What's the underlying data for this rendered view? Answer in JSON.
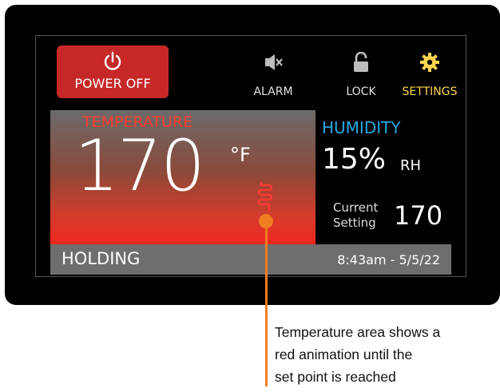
{
  "controls": {
    "power_label": "POWER OFF",
    "alarm_label": "ALARM",
    "lock_label": "LOCK",
    "settings_label": "SETTINGS"
  },
  "temperature": {
    "title": "TEMPERATURE",
    "value": "170",
    "unit": "°F"
  },
  "humidity": {
    "title": "HUMIDITY",
    "value": "15%",
    "unit": "RH"
  },
  "current_setting": {
    "label_line1": "Current",
    "label_line2": "Setting",
    "value": "170"
  },
  "status": {
    "text": "HOLDING",
    "datetime": "8:43am - 5/5/22"
  },
  "callout": {
    "line1": "Temperature area shows a",
    "line2": "red animation until the",
    "line3": "set point is reached"
  },
  "colors": {
    "power": "#c62828",
    "temperature": "#ff3b30",
    "humidity": "#29a8e0",
    "settings": "#ffd54f",
    "callout": "#ef7d22"
  }
}
